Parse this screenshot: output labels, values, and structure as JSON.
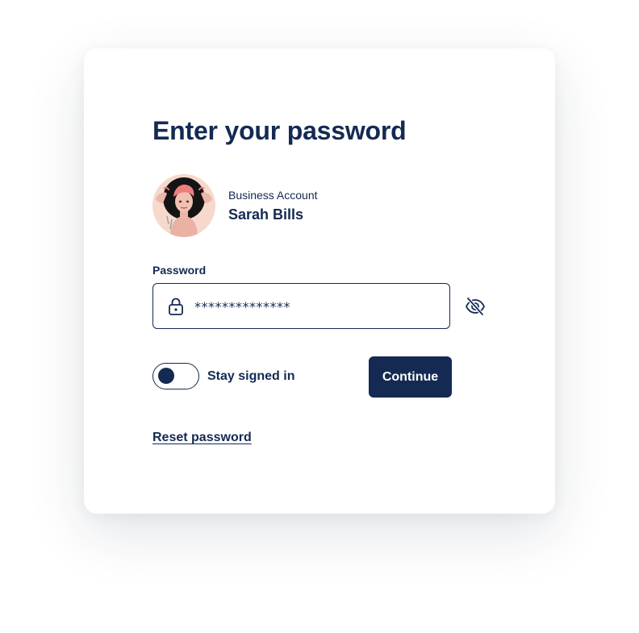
{
  "colors": {
    "primary": "#142a52",
    "background": "#ffffff",
    "avatar_bg": "#f6d9cc"
  },
  "login": {
    "title": "Enter your password",
    "account": {
      "type": "Business Account",
      "name": "Sarah Bills",
      "avatar": "user-photo"
    },
    "password": {
      "label": "Password",
      "value": "**************",
      "lock_icon": "lock-icon",
      "visibility_icon": "eye-off-icon"
    },
    "stay_signed_in": {
      "label": "Stay signed in"
    },
    "continue_label": "Continue",
    "reset_label": "Reset password"
  }
}
